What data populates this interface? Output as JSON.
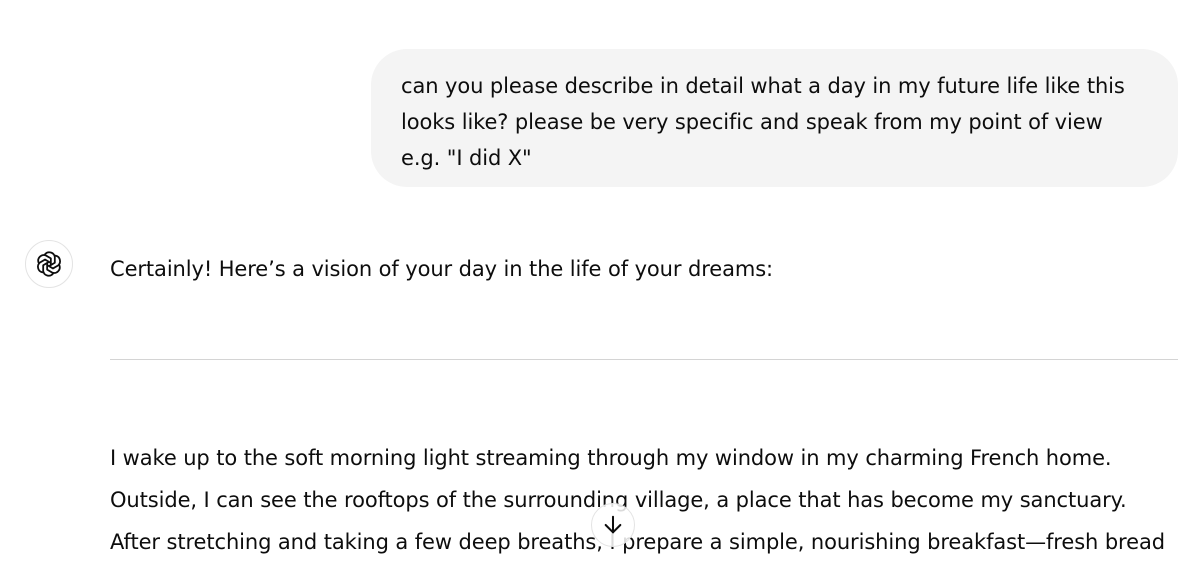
{
  "conversation": {
    "user_message": {
      "lines": [
        "can you please describe in detail what a day in my future life like this",
        "looks like? please be very specific and speak from my point of view",
        "e.g. \"I did X\""
      ]
    },
    "assistant": {
      "avatar_icon": "openai-logo-icon",
      "intro": "Certainly! Here’s a vision of your day in the life of your dreams:",
      "body_lines": [
        "I wake up to the soft morning light streaming through my window in my charming French home.",
        "Outside, I can see the rooftops of the surrounding village, a place that has become my sanctuary.",
        "After stretching and taking a few deep breaths, I prepare a simple, nourishing breakfast—fresh bread"
      ]
    }
  },
  "scroll_button": {
    "icon": "arrow-down-icon"
  }
}
